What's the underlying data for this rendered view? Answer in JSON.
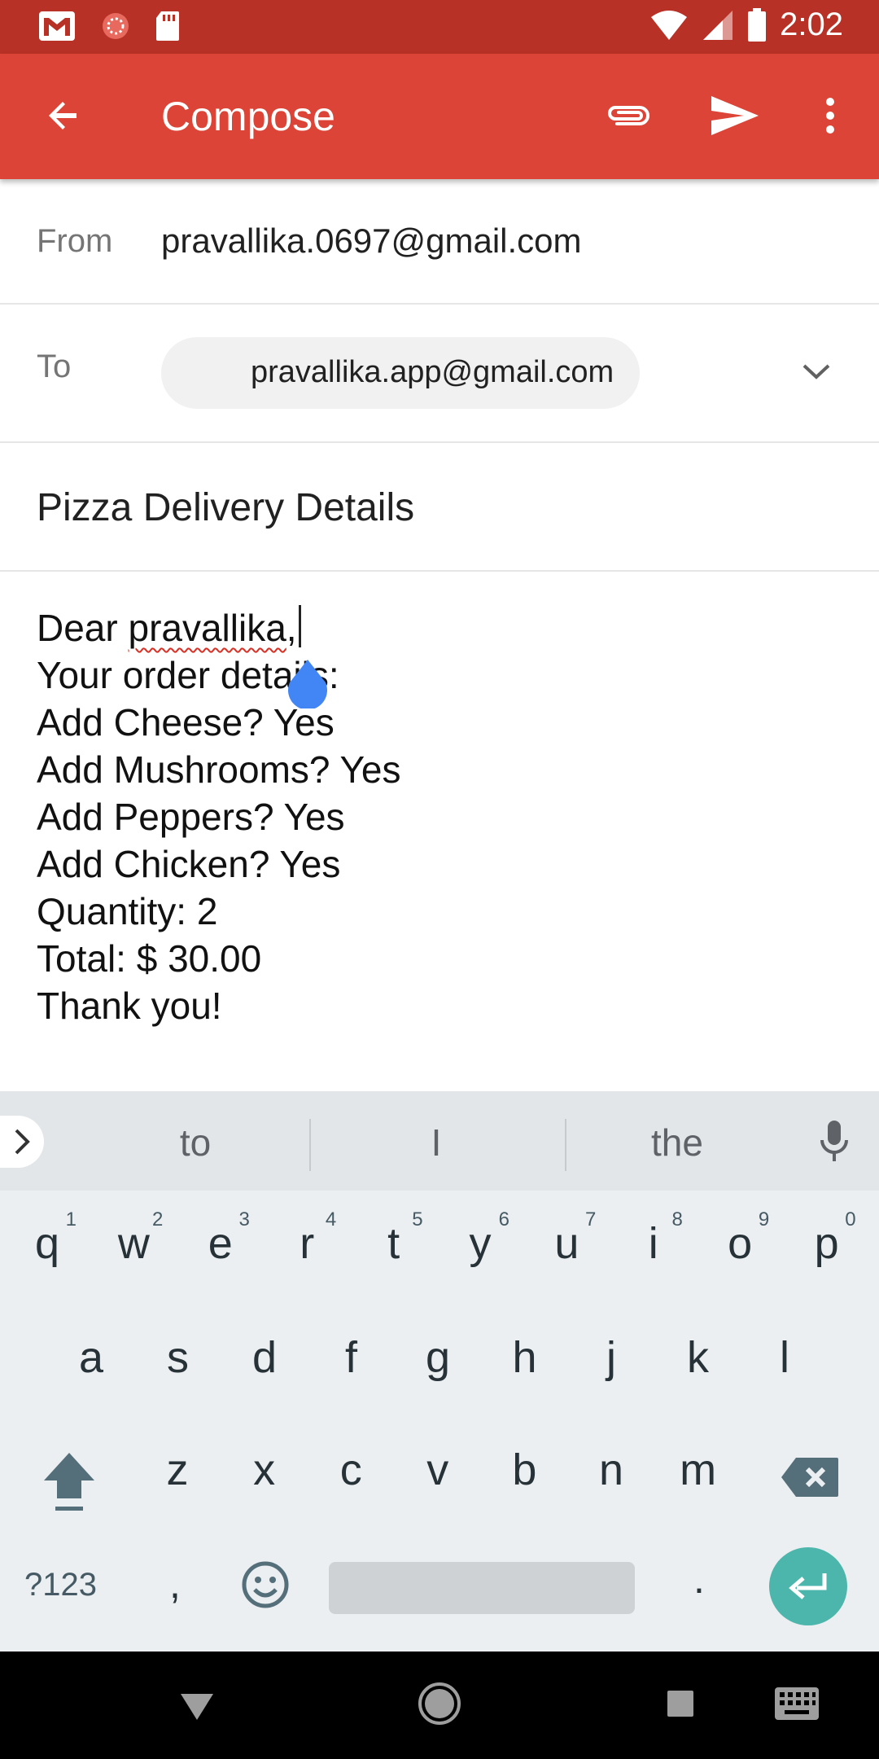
{
  "status_bar": {
    "time": "2:02",
    "icons": [
      "gmail-icon",
      "sync-icon",
      "sd-card-icon",
      "wifi-icon",
      "signal-icon",
      "battery-icon"
    ]
  },
  "app_bar": {
    "title": "Compose",
    "icons": [
      "back-arrow-icon",
      "attach-icon",
      "send-icon",
      "more-icon"
    ],
    "color": "#db4437",
    "status_color": "#b83126"
  },
  "fields": {
    "from_label": "From",
    "from_value": "pravallika.0697@gmail.com",
    "to_label": "To",
    "to_chip": "pravallika.app@gmail.com",
    "subject": "Pizza Delivery Details"
  },
  "body": {
    "greeting_prefix": "Dear ",
    "greeting_name": "pravallika",
    "greeting_suffix": ",",
    "lines": [
      "Your order details:",
      "Add Cheese? Yes",
      "Add Mushrooms? Yes",
      "Add Peppers? Yes",
      "Add Chicken? Yes",
      "Quantity: 2",
      "Total: $ 30.00",
      "Thank you!"
    ]
  },
  "keyboard": {
    "suggestions": [
      "to",
      "I",
      "the"
    ],
    "row1": [
      "q",
      "w",
      "e",
      "r",
      "t",
      "y",
      "u",
      "i",
      "o",
      "p"
    ],
    "row1_numbers": [
      "1",
      "2",
      "3",
      "4",
      "5",
      "6",
      "7",
      "8",
      "9",
      "0"
    ],
    "row2": [
      "a",
      "s",
      "d",
      "f",
      "g",
      "h",
      "j",
      "k",
      "l"
    ],
    "row3": [
      "z",
      "x",
      "c",
      "v",
      "b",
      "n",
      "m"
    ],
    "symbols_label": "?123",
    "comma": ",",
    "period": ".",
    "enter_color": "#4db6ac"
  }
}
